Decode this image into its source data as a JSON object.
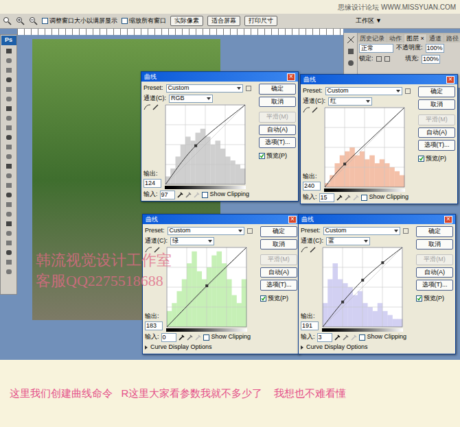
{
  "watermark": "思缘设计论坛 WWW.MISSYUAN.COM",
  "toolbar": {
    "checkboxes": [
      {
        "label": "调整窗口大小以满屏显示",
        "checked": false
      },
      {
        "label": "缩放所有窗口",
        "checked": false
      }
    ],
    "buttons": [
      "实际像素",
      "适合屏幕",
      "打印尺寸"
    ],
    "workspace": "工作区 ▼"
  },
  "tools": {
    "logo": "Ps"
  },
  "layers_panel": {
    "tabs": [
      {
        "label": "历史记录",
        "selected": false
      },
      {
        "label": "动作",
        "selected": false
      },
      {
        "label": "图层 ×",
        "selected": true
      },
      {
        "label": "通道",
        "selected": false
      },
      {
        "label": "路径",
        "selected": false
      }
    ],
    "blend_mode": "正常",
    "opacity_label": "不透明度:",
    "opacity": "100%",
    "lock_label": "锁定:",
    "fill_label": "填充:",
    "fill": "100%"
  },
  "studio_watermark": [
    "韩流视觉设计工作室",
    "客服QQ2275518688"
  ],
  "dialogs": [
    {
      "title": "曲线",
      "close": "×",
      "preset_label": "Preset:",
      "preset": "Custom",
      "channel_label": "通道(C):",
      "channel": "RGB",
      "output_label": "输出:",
      "output": "124",
      "input_label": "输入:",
      "input": "97",
      "show_clipping": {
        "label": "Show Clipping",
        "checked": false
      },
      "buttons": [
        {
          "label": "确定",
          "disabled": false
        },
        {
          "label": "取消",
          "disabled": false
        },
        {
          "label": "平滑(M)",
          "disabled": true
        },
        {
          "label": "自动(A)",
          "disabled": false
        },
        {
          "label": "选项(T)...",
          "disabled": false
        }
      ],
      "preview": {
        "label": "预览(P)",
        "checked": true
      },
      "display_options": "",
      "color": "#cfcfcf",
      "histogram": [
        0.1,
        0.2,
        0.35,
        0.5,
        0.6,
        0.55,
        0.65,
        0.7,
        0.6,
        0.5,
        0.55,
        0.45,
        0.35,
        0.3,
        0.25,
        0.2
      ],
      "points": [
        [
          0,
          0
        ],
        [
          97,
          124
        ],
        [
          255,
          255
        ]
      ]
    },
    {
      "title": "曲线",
      "close": "×",
      "preset_label": "Preset:",
      "preset": "Custom",
      "channel_label": "通道(C):",
      "channel": "红",
      "output_label": "输出:",
      "output": "240",
      "input_label": "输入:",
      "input": "15",
      "show_clipping": {
        "label": "Show Clipping",
        "checked": false
      },
      "buttons": [
        {
          "label": "确定",
          "disabled": false
        },
        {
          "label": "取消",
          "disabled": false
        },
        {
          "label": "平滑(M)",
          "disabled": true
        },
        {
          "label": "自动(A)",
          "disabled": false
        },
        {
          "label": "选项(T)...",
          "disabled": false
        }
      ],
      "preview": {
        "label": "预览(P)",
        "checked": true
      },
      "display_options": "",
      "color": "#f4c0a8",
      "histogram": [
        0.05,
        0.15,
        0.3,
        0.4,
        0.45,
        0.5,
        0.4,
        0.45,
        0.35,
        0.4,
        0.3,
        0.35,
        0.3,
        0.25,
        0.2,
        0.15
      ],
      "points": [
        [
          0,
          0
        ],
        [
          64,
          74
        ],
        [
          255,
          255
        ]
      ]
    },
    {
      "title": "曲线",
      "close": "×",
      "preset_label": "Preset:",
      "preset": "Custom",
      "channel_label": "通道(C):",
      "channel": "绿",
      "output_label": "输出:",
      "output": "183",
      "input_label": "输入:",
      "input": "0",
      "show_clipping": {
        "label": "Show Clipping",
        "checked": false
      },
      "buttons": [
        {
          "label": "确定",
          "disabled": false
        },
        {
          "label": "取消",
          "disabled": false
        },
        {
          "label": "平滑(M)",
          "disabled": true
        },
        {
          "label": "自动(A)",
          "disabled": false
        },
        {
          "label": "选项(T)...",
          "disabled": false
        }
      ],
      "preview": {
        "label": "预览(P)",
        "checked": true
      },
      "display_options": "Curve Display Options",
      "color": "#c6f0b6",
      "histogram": [
        0.2,
        0.3,
        0.45,
        0.6,
        0.8,
        0.95,
        0.7,
        0.6,
        0.75,
        0.9,
        0.95,
        0.8,
        0.6,
        0.4,
        0.3,
        0.6
      ],
      "points": [
        [
          0,
          0
        ],
        [
          128,
          132
        ],
        [
          255,
          255
        ]
      ]
    },
    {
      "title": "曲线",
      "close": "×",
      "preset_label": "Preset:",
      "preset": "Custom",
      "channel_label": "通道(C):",
      "channel": "蓝",
      "output_label": "输出:",
      "output": "191",
      "input_label": "输入:",
      "input": "3",
      "show_clipping": {
        "label": "Show Clipping",
        "checked": false
      },
      "buttons": [
        {
          "label": "确定",
          "disabled": false
        },
        {
          "label": "取消",
          "disabled": false
        },
        {
          "label": "平滑(M)",
          "disabled": true
        },
        {
          "label": "自动(A)",
          "disabled": false
        },
        {
          "label": "选项(T)...",
          "disabled": false
        }
      ],
      "preview": {
        "label": "预览(P)",
        "checked": true
      },
      "display_options": "Curve Display Options",
      "color": "#d2d0f2",
      "histogram": [
        0.3,
        0.6,
        0.8,
        0.6,
        0.55,
        0.5,
        0.4,
        0.45,
        0.3,
        0.25,
        0.2,
        0.3,
        0.2,
        0.15,
        0.1,
        0.1
      ],
      "points": [
        [
          0,
          0
        ],
        [
          64,
          80
        ],
        [
          128,
          150
        ],
        [
          192,
          206
        ],
        [
          255,
          255
        ]
      ]
    }
  ],
  "caption": "这里我们创建曲线命令   R这里大家看参数我就不多少了    我想也不难看懂"
}
